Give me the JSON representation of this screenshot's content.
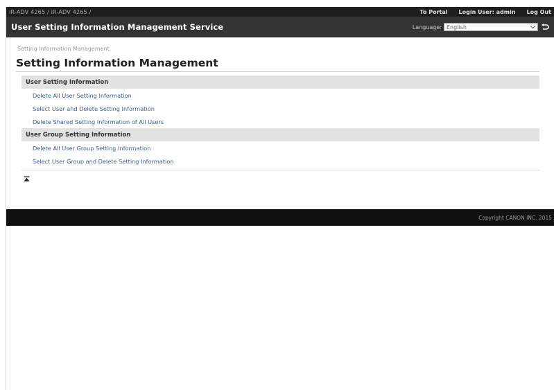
{
  "topbar": {
    "device": "iR-ADV 4265 / iR-ADV 4265 /",
    "to_portal": "To Portal",
    "login_user": "Login User:  admin",
    "logout": "Log Out"
  },
  "header": {
    "title": "User Setting Information Management Service",
    "language_label": "Language:",
    "language_value": "English"
  },
  "breadcrumb": "Setting Information Management",
  "page_title": "Setting Information Management",
  "sections": [
    {
      "title": "User Setting Information",
      "links": [
        "Delete All User Setting Information",
        "Select User and Delete Setting Information",
        "Delete Shared Setting Information of All Users"
      ]
    },
    {
      "title": "User Group Setting Information",
      "links": [
        "Delete All User Group Setting Information",
        "Select User Group and Delete Setting Information"
      ]
    }
  ],
  "footer": "Copyright CANON INC. 2015",
  "icons": {
    "apply": "apply-arrow-icon",
    "back_to_top": "back-to-top-icon",
    "dropdown": "chevron-down-icon"
  }
}
